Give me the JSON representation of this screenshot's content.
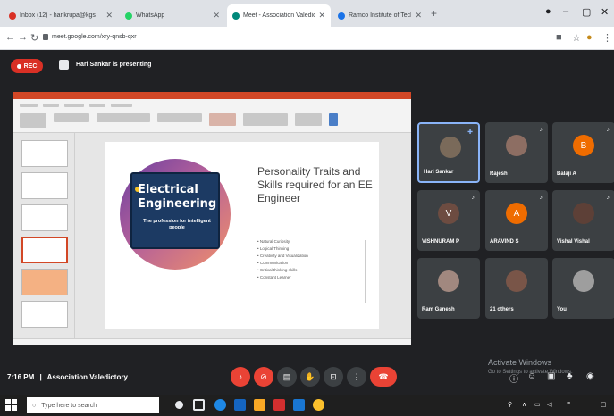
{
  "browser": {
    "tabs": [
      {
        "label": "Inbox (12) - harikrupa@kgs",
        "color": "#d93025",
        "active": false
      },
      {
        "label": "WhatsApp",
        "color": "#25d366",
        "active": false
      },
      {
        "label": "Meet - Association Valedict",
        "color": "#00897b",
        "active": true
      },
      {
        "label": "Ramco Institute of Technology",
        "color": "#1a73e8",
        "active": false
      }
    ],
    "new_tab": "+",
    "url": "meet.google.com/xry-qnsb-qxr",
    "minimize": "–",
    "restore": "▢",
    "close": "✕"
  },
  "meet": {
    "rec_label": "REC",
    "presenting_text": "Hari Sankar is presenting",
    "clock": "7:16 PM",
    "divider": "|",
    "meeting_name": "Association Valedictory",
    "watermark_line1": "Activate Windows",
    "watermark_line2": "Go to Settings to activate Windows.",
    "participants": [
      {
        "name": "Hari Sankar",
        "avatar_color": "#7a6a5a",
        "initial": "",
        "active": true
      },
      {
        "name": "Rajesh",
        "avatar_color": "#8d6e63",
        "initial": "",
        "active": false
      },
      {
        "name": "Balaji A",
        "avatar_color": "#ef6c00",
        "initial": "B",
        "active": false
      },
      {
        "name": "VISHNURAM P",
        "avatar_color": "#6d4c41",
        "initial": "V",
        "active": false
      },
      {
        "name": "ARAVIND S",
        "avatar_color": "#ef6c00",
        "initial": "A",
        "active": false
      },
      {
        "name": "Vishal Vishal",
        "avatar_color": "#5d4037",
        "initial": "",
        "active": false
      },
      {
        "name": "Ram Ganesh",
        "avatar_color": "#a1887f",
        "initial": "",
        "active": false
      },
      {
        "name": "21 others",
        "avatar_color": "#795548",
        "initial": "",
        "active": false
      },
      {
        "name": "You",
        "avatar_color": "#9e9e9e",
        "initial": "",
        "active": false
      }
    ]
  },
  "slide": {
    "logo_line1": "Electrical",
    "logo_line2": "Engineering",
    "logo_sub": "The profession for intelligent people",
    "title": "Personality Traits and Skills required for an EE Engineer",
    "bullets": [
      "• Natural Curiosity",
      "• Logical Thinking",
      "• Creativity and Visualization",
      "• Communication",
      "• Critical thinking skills",
      "• Constant Learner"
    ]
  },
  "taskbar": {
    "search_placeholder": "Type here to search"
  }
}
